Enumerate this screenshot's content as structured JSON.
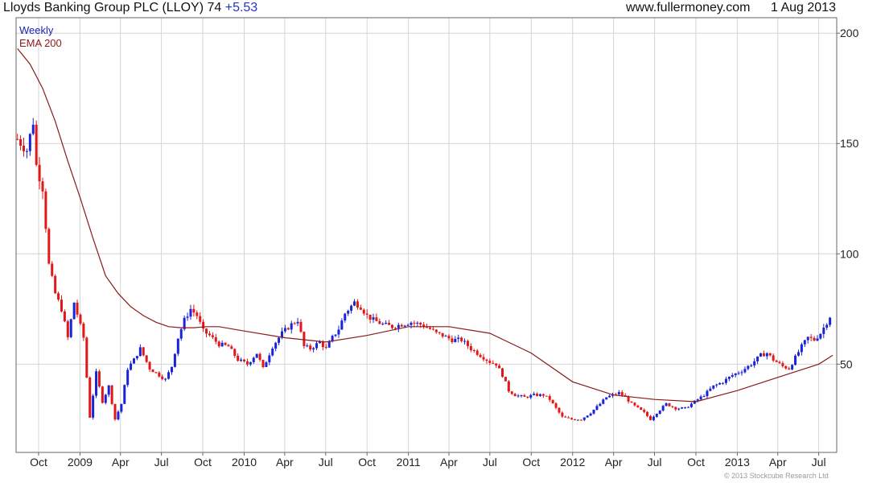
{
  "header": {
    "title": "Lloyds Banking Group PLC (LLOY) 74",
    "change": "+5.53",
    "site": "www.fullermoney.com",
    "date": "1 Aug 2013"
  },
  "legend": {
    "weekly": "Weekly",
    "ema": "EMA 200"
  },
  "footer": "© 2013 Stockcube Research Ltd",
  "colors": {
    "up": "#1a23d6",
    "down": "#e01818",
    "ema": "#8b1a1a",
    "grid": "#d4d4d4",
    "axis": "#666666"
  },
  "chart_data": {
    "type": "candlestick",
    "title": "Lloyds Banking Group PLC (LLOY) 74",
    "ylim": [
      10,
      207
    ],
    "y_ticks": [
      50,
      100,
      150,
      200
    ],
    "grid": true,
    "y_axis_side": "right",
    "legend_position": "top-left",
    "x_tick_labels": [
      "Oct",
      "2009",
      "Apr",
      "Jul",
      "Oct",
      "2010",
      "Apr",
      "Jul",
      "Oct",
      "2011",
      "Apr",
      "Jul",
      "Oct",
      "2012",
      "Apr",
      "Jul",
      "Oct",
      "2013",
      "Apr",
      "Jul"
    ],
    "x_tick_dates": [
      "2008-10-01",
      "2009-01-01",
      "2009-04-01",
      "2009-07-01",
      "2009-10-01",
      "2010-01-01",
      "2010-04-01",
      "2010-07-01",
      "2010-10-01",
      "2011-01-01",
      "2011-04-01",
      "2011-07-01",
      "2011-10-01",
      "2012-01-01",
      "2012-04-01",
      "2012-07-01",
      "2012-10-01",
      "2013-01-01",
      "2013-04-01",
      "2013-07-01"
    ],
    "x_range": [
      "2008-08-12",
      "2013-08-10"
    ],
    "price_anchors": {
      "dates": [
        "2008-08-15",
        "2008-09-05",
        "2008-09-19",
        "2008-09-26",
        "2008-10-10",
        "2008-10-24",
        "2008-11-07",
        "2008-11-21",
        "2008-12-05",
        "2008-12-19",
        "2009-01-09",
        "2009-01-23",
        "2009-02-06",
        "2009-02-20",
        "2009-03-06",
        "2009-03-20",
        "2009-04-03",
        "2009-04-17",
        "2009-05-01",
        "2009-05-15",
        "2009-06-05",
        "2009-06-26",
        "2009-07-10",
        "2009-07-24",
        "2009-08-07",
        "2009-08-21",
        "2009-09-04",
        "2009-09-18",
        "2009-10-02",
        "2009-10-16",
        "2009-11-06",
        "2009-11-27",
        "2009-12-18",
        "2010-01-08",
        "2010-01-29",
        "2010-02-12",
        "2010-03-05",
        "2010-03-26",
        "2010-04-16",
        "2010-04-30",
        "2010-05-14",
        "2010-05-28",
        "2010-06-18",
        "2010-07-02",
        "2010-07-16",
        "2010-07-30",
        "2010-08-13",
        "2010-09-03",
        "2010-09-17",
        "2010-10-01",
        "2010-10-15",
        "2010-11-05",
        "2010-11-26",
        "2010-12-17",
        "2011-01-07",
        "2011-01-28",
        "2011-02-18",
        "2011-03-04",
        "2011-03-18",
        "2011-04-08",
        "2011-04-29",
        "2011-05-20",
        "2011-06-10",
        "2011-07-01",
        "2011-07-15",
        "2011-07-29",
        "2011-08-12",
        "2011-08-26",
        "2011-09-16",
        "2011-10-07",
        "2011-10-28",
        "2011-11-11",
        "2011-11-25",
        "2011-12-09",
        "2011-12-30",
        "2012-01-20",
        "2012-02-10",
        "2012-03-02",
        "2012-03-16",
        "2012-03-30",
        "2012-04-13",
        "2012-04-27",
        "2012-05-11",
        "2012-05-25",
        "2012-06-08",
        "2012-06-22",
        "2012-07-06",
        "2012-07-27",
        "2012-08-17",
        "2012-09-07",
        "2012-09-28",
        "2012-10-19",
        "2012-11-09",
        "2012-11-30",
        "2012-12-21",
        "2013-01-11",
        "2013-02-01",
        "2013-02-22",
        "2013-03-08",
        "2013-03-22",
        "2013-04-12",
        "2013-04-26",
        "2013-05-10",
        "2013-05-24",
        "2013-06-07",
        "2013-06-21",
        "2013-07-05",
        "2013-07-19",
        "2013-08-01"
      ],
      "close": [
        152,
        147,
        160,
        140,
        130,
        95,
        82,
        75,
        62,
        78,
        62,
        26,
        46,
        33,
        40,
        25,
        32,
        48,
        52,
        57,
        48,
        45,
        43,
        49,
        62,
        70,
        75,
        72,
        65,
        63,
        59,
        58,
        52,
        50,
        55,
        48,
        58,
        64,
        68,
        70,
        58,
        57,
        60,
        57,
        62,
        66,
        73,
        78,
        76,
        72,
        70,
        68,
        67,
        68,
        69,
        68,
        66,
        64,
        63,
        61,
        61,
        57,
        54,
        51,
        50,
        45,
        38,
        36,
        35,
        36,
        36,
        34,
        30,
        26,
        25,
        25,
        28,
        32,
        35,
        36,
        37,
        35,
        32,
        30,
        28,
        25,
        28,
        32,
        30,
        30,
        33,
        36,
        40,
        42,
        45,
        47,
        50,
        54,
        55,
        52,
        49,
        48,
        53,
        58,
        62,
        61,
        64,
        69,
        74
      ]
    },
    "ema200": {
      "dates": [
        "2008-08-15",
        "2008-09-12",
        "2008-10-10",
        "2008-11-07",
        "2008-12-05",
        "2009-01-02",
        "2009-01-30",
        "2009-02-27",
        "2009-03-27",
        "2009-04-24",
        "2009-05-22",
        "2009-06-19",
        "2009-07-17",
        "2009-08-14",
        "2009-09-11",
        "2009-10-09",
        "2009-11-06",
        "2010-01-01",
        "2010-04-01",
        "2010-07-01",
        "2010-10-01",
        "2011-01-01",
        "2011-04-01",
        "2011-07-01",
        "2011-10-01",
        "2012-01-01",
        "2012-04-01",
        "2012-07-01",
        "2012-10-01",
        "2013-01-01",
        "2013-04-01",
        "2013-07-01",
        "2013-08-01"
      ],
      "values": [
        193,
        186,
        175,
        160,
        142,
        125,
        107,
        90,
        82,
        76,
        72,
        69,
        67,
        66.5,
        66.5,
        67,
        67,
        65,
        62,
        60,
        63,
        67,
        67,
        64,
        55,
        42,
        36,
        34,
        33,
        38,
        44,
        50,
        54
      ]
    }
  }
}
